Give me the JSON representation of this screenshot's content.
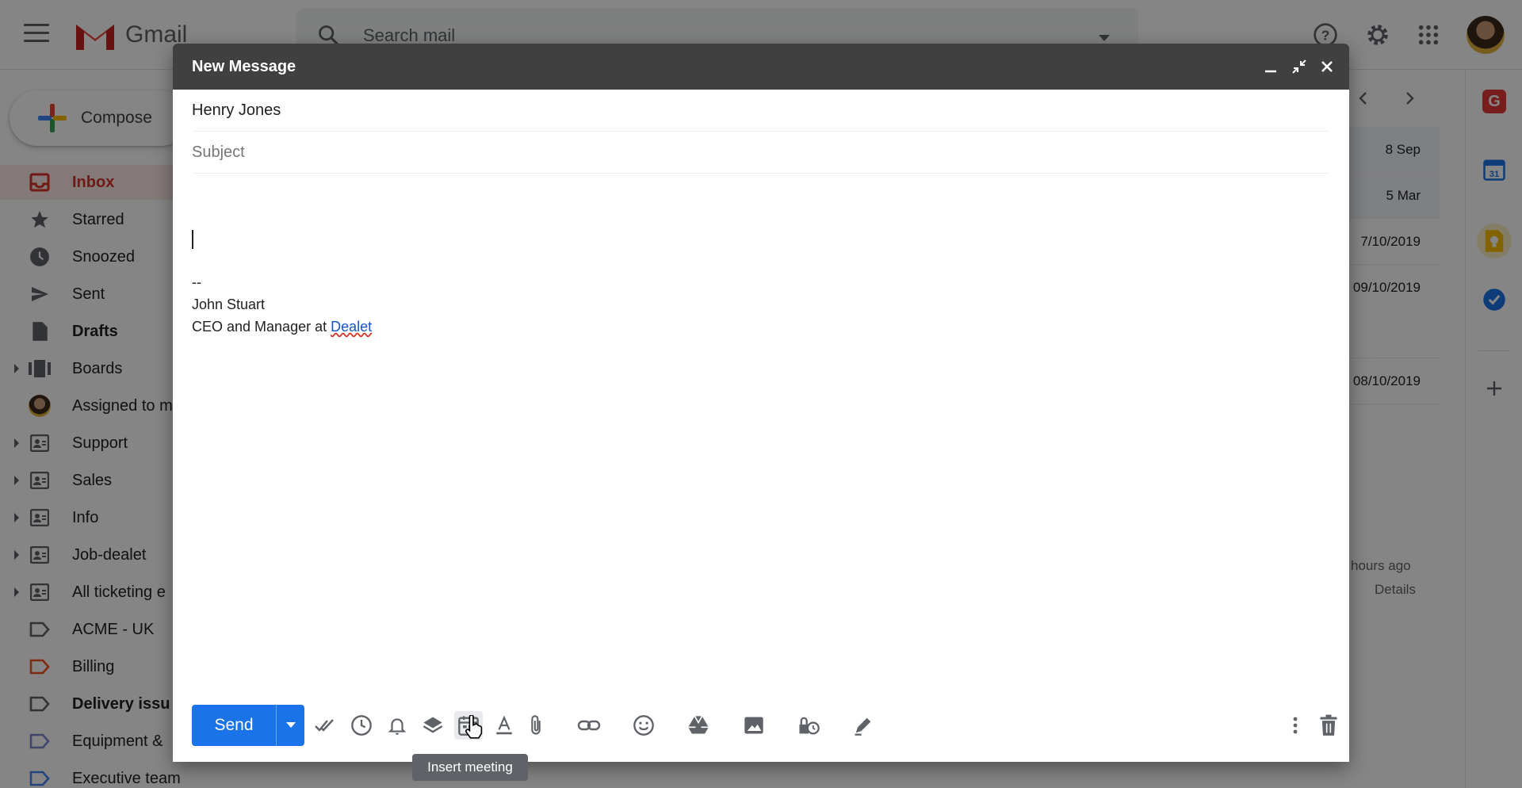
{
  "app": {
    "name": "Gmail",
    "search_placeholder": "Search mail",
    "compose_label": "Compose"
  },
  "sidebar": {
    "items": [
      {
        "label": "Inbox",
        "icon": "inbox-icon",
        "active": true
      },
      {
        "label": "Starred",
        "icon": "star-icon"
      },
      {
        "label": "Snoozed",
        "icon": "clock-icon"
      },
      {
        "label": "Sent",
        "icon": "send-icon"
      },
      {
        "label": "Drafts",
        "icon": "draft-icon",
        "bold": true
      },
      {
        "label": "Boards",
        "icon": "boards-icon",
        "expandable": true
      },
      {
        "label": "Assigned to m",
        "icon": "avatar-icon"
      },
      {
        "label": "Support",
        "icon": "shared-inbox-icon",
        "expandable": true
      },
      {
        "label": "Sales",
        "icon": "shared-inbox-icon",
        "expandable": true
      },
      {
        "label": "Info",
        "icon": "shared-inbox-icon",
        "expandable": true
      },
      {
        "label": "Job-dealet",
        "icon": "shared-inbox-icon",
        "expandable": true
      },
      {
        "label": "All ticketing e",
        "icon": "shared-inbox-icon",
        "expandable": true
      },
      {
        "label": "ACME - UK",
        "icon": "label-icon"
      },
      {
        "label": "Billing",
        "icon": "label-icon"
      },
      {
        "label": "Delivery issu",
        "icon": "label-icon",
        "bold": true
      },
      {
        "label": "Equipment &",
        "icon": "label-icon"
      },
      {
        "label": "Executive team",
        "icon": "label-icon"
      }
    ]
  },
  "mail_list": {
    "dates": [
      "8 Sep",
      "5 Mar",
      "7/10/2019",
      "09/10/2019",
      "08/10/2019"
    ],
    "activity_text": "hours ago",
    "details_text": "Details"
  },
  "compose": {
    "title": "New Message",
    "to": "Henry Jones",
    "subject_placeholder": "Subject",
    "signature": {
      "separator": "--",
      "name": "John Stuart",
      "role_prefix": "CEO and Manager at ",
      "company": "Dealet"
    },
    "send_label": "Send",
    "tooltip": "Insert meeting"
  },
  "colors": {
    "send_button": "#1a73e8",
    "header_bar": "#404040",
    "inbox_active": "#d93025"
  }
}
